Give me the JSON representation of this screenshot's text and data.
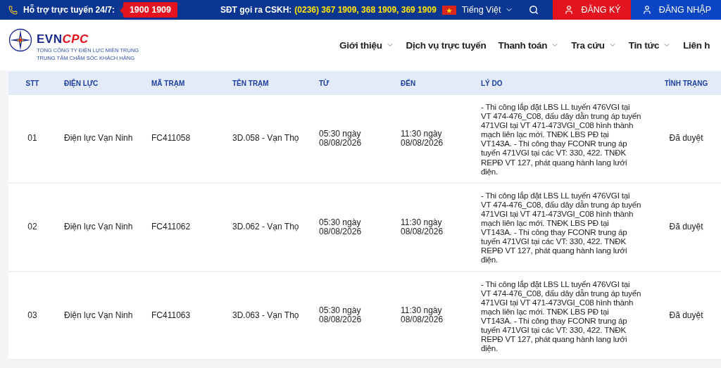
{
  "top_bar": {
    "support_label": "Hỗ trợ trực tuyến 24/7:",
    "hotline": "1900 1909",
    "cskh_label": "SĐT gọi ra CSKH:",
    "cskh_numbers": "(0236) 367 1909, 368 1909, 369 1909",
    "language": "Tiếng Việt",
    "register": "ĐĂNG KÝ",
    "login": "ĐĂNG NHẬP"
  },
  "logo": {
    "brand_main": "EVN",
    "brand_accent": "CPC",
    "line_1": "TỔNG CÔNG TY ĐIỆN LỰC MIỀN TRUNG",
    "line_2": "TRUNG TÂM CHĂM SÓC KHÁCH HÀNG"
  },
  "nav": [
    {
      "label": "Giới thiệu",
      "has_menu": true
    },
    {
      "label": "Dịch vụ trực tuyến",
      "has_menu": false
    },
    {
      "label": "Thanh toán",
      "has_menu": true
    },
    {
      "label": "Tra cứu",
      "has_menu": true
    },
    {
      "label": "Tin tức",
      "has_menu": true
    },
    {
      "label": "Liên h",
      "has_menu": false
    }
  ],
  "table": {
    "columns": [
      "STT",
      "ĐIỆN LỰC",
      "MÃ TRẠM",
      "TÊN TRẠM",
      "TỪ",
      "ĐẾN",
      "LÝ DO",
      "TÌNH TRẠNG"
    ],
    "rows": [
      [
        "01",
        "Điện lực Vạn Ninh",
        "FC411058",
        "3D.058 - Vạn Thọ",
        "05:30 ngày 08/08/2026",
        "11:30 ngày 08/08/2026",
        "- Thi công lắp đặt LBS LL tuyến 476VGI tại VT 474-476_C08, đấu dây dẫn trung áp tuyến 471VGI tại VT 471-473VGI_C08 hình thành mạch liên lạc mới. TNĐK LBS PĐ tại VT143A. - Thi công thay FCONR trung áp tuyến 471VGI tại các VT: 330, 422. TNĐK REPĐ VT 127, phát quang hành lang lưới điện.",
        "Đã duyệt"
      ],
      [
        "02",
        "Điện lực Vạn Ninh",
        "FC411062",
        "3D.062 - Vạn Thọ",
        "05:30 ngày 08/08/2026",
        "11:30 ngày 08/08/2026",
        "- Thi công lắp đặt LBS LL tuyến 476VGI tại VT 474-476_C08, đấu dây dẫn trung áp tuyến 471VGI tại VT 471-473VGI_C08 hình thành mạch liên lạc mới. TNĐK LBS PĐ tại VT143A. - Thi công thay FCONR trung áp tuyến 471VGI tại các VT: 330, 422. TNĐK REPĐ VT 127, phát quang hành lang lưới điện.",
        "Đã duyệt"
      ],
      [
        "03",
        "Điện lực Vạn Ninh",
        "FC411063",
        "3D.063 - Vạn Thọ",
        "05:30 ngày 08/08/2026",
        "11:30 ngày 08/08/2026",
        "- Thi công lắp đặt LBS LL tuyến 476VGI tại VT 474-476_C08, đấu dây dẫn trung áp tuyến 471VGI tại VT 471-473VGI_C08 hình thành mạch liên lạc mới. TNĐK LBS PĐ tại VT143A. - Thi công thay FCONR trung áp tuyến 471VGI tại các VT: 330, 422. TNĐK REPĐ VT 127, phát quang hành lang lưới điện.",
        "Đã duyệt"
      ]
    ]
  }
}
